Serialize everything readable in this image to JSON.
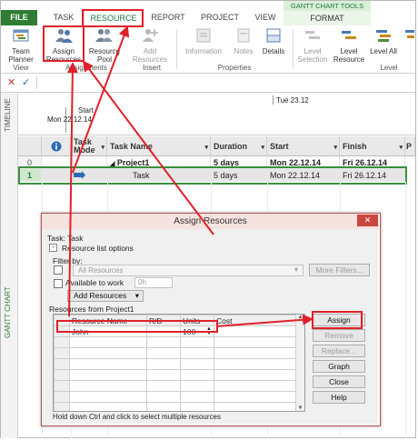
{
  "ribbon_tabs": {
    "file": "FILE",
    "task": "TASK",
    "resource": "RESOURCE",
    "report": "REPORT",
    "project": "PROJECT",
    "view": "VIEW",
    "context_header": "GANTT CHART TOOLS",
    "format": "FORMAT"
  },
  "ribbon": {
    "team_planner": "Team Planner",
    "assign_resources": "Assign Resources",
    "resource_pool": "Resource Pool",
    "add_resources": "Add Resources",
    "information": "Information",
    "notes": "Notes",
    "details": "Details",
    "level_selection": "Level Selection",
    "level_resource": "Level Resource",
    "level_all": "Level All",
    "groups": {
      "view": "View",
      "assignments": "Assignments",
      "insert": "Insert",
      "properties": "Properties",
      "level": "Level"
    }
  },
  "timeline": {
    "side_label": "TIMELINE",
    "date_tick": "Tue 23.12",
    "start_label": "Start",
    "start_date": "Mon 22.12.14"
  },
  "grid": {
    "side_label": "GANTT CHART",
    "headers": {
      "task_mode": "Task Mode",
      "task_name": "Task Name",
      "duration": "Duration",
      "start": "Start",
      "finish": "Finish",
      "extra": "P"
    },
    "rows": [
      {
        "num": "0",
        "name": "Project1",
        "duration": "5 days",
        "start": "Mon 22.12.14",
        "finish": "Fri 26.12.14"
      },
      {
        "num": "1",
        "name": "Task",
        "duration": "5 days",
        "start": "Mon 22.12.14",
        "finish": "Fri 26.12.14"
      }
    ]
  },
  "dialog": {
    "title": "Assign Resources",
    "task_line": "Task: Task",
    "list_options": "Resource list options",
    "filter_by": "Filter by:",
    "filter_value": "All Resources",
    "more_filters": "More Filters...",
    "available_to_work": "Available to work",
    "available_hours": "0h",
    "add_resources": "Add Resources",
    "resources_from": "Resources from Project1",
    "columns": {
      "resource_name": "Resource Name",
      "rd": "R/D",
      "units": "Units",
      "cost": "Cost"
    },
    "resource_name": "John",
    "units": "100",
    "buttons": {
      "assign": "Assign",
      "remove": "Remove",
      "replace": "Replace...",
      "graph": "Graph",
      "close": "Close",
      "help": "Help"
    },
    "hint": "Hold down Ctrl and click to select multiple resources",
    "close_glyph": "✕"
  },
  "colors": {
    "file_green": "#2f7d32",
    "annotation_red": "#e0202a",
    "selection_green": "#217346"
  }
}
